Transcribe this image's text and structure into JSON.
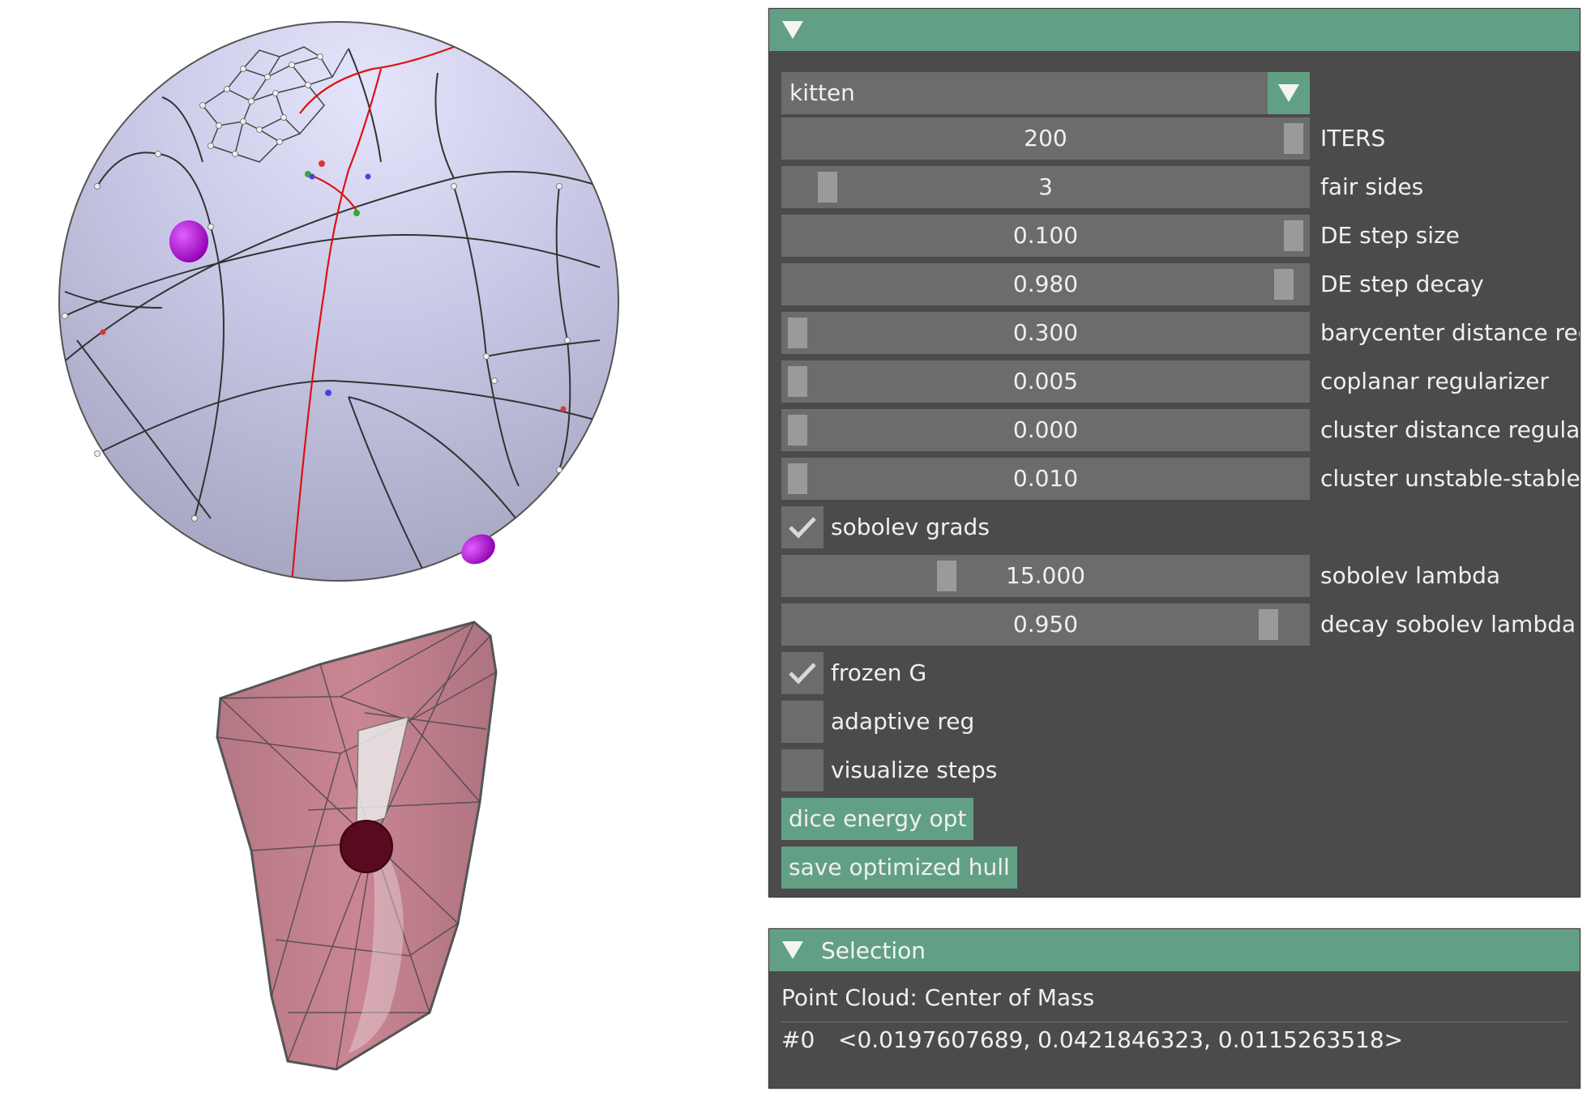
{
  "colors": {
    "accent": "#62a085",
    "panel_bg": "#4b4b4b",
    "widget_bg": "#6c6c6c",
    "sphere": "#c8c8e6",
    "hull": "#b06070",
    "marker": "#b000c8",
    "path": "#dd1111"
  },
  "main_panel": {
    "collapse_icon": "triangle-down-icon",
    "mesh_select": {
      "value": "kitten",
      "icon": "chevron-down-icon"
    },
    "sliders": [
      {
        "name": "iters",
        "value": "200",
        "label": "ITERS",
        "level": 1.0
      },
      {
        "name": "fair-sides",
        "value": "3",
        "label": "fair sides",
        "level": 0.06
      },
      {
        "name": "de-step-size",
        "value": "0.100",
        "label": "DE step size",
        "level": 1.0
      },
      {
        "name": "de-step-decay",
        "value": "0.980",
        "label": "DE step decay",
        "level": 0.98
      },
      {
        "name": "barycenter-distance",
        "value": "0.300",
        "label": "barycenter distance regu",
        "level": 0.0
      },
      {
        "name": "coplanar-regularizer",
        "value": "0.005",
        "label": "coplanar regularizer",
        "level": 0.0
      },
      {
        "name": "cluster-distance",
        "value": "0.000",
        "label": "cluster distance regulariz",
        "level": 0.0
      },
      {
        "name": "cluster-unstable-stable",
        "value": "0.010",
        "label": "cluster unstable-stable a",
        "level": 0.0
      }
    ],
    "sobolev_grads": {
      "label": "sobolev grads",
      "checked": true
    },
    "sliders2": [
      {
        "name": "sobolev-lambda",
        "value": "15.000",
        "label": "sobolev lambda",
        "level": 0.3
      },
      {
        "name": "decay-sobolev-lambda",
        "value": "0.950",
        "label": "decay sobolev lambda",
        "level": 0.95
      }
    ],
    "frozen_g": {
      "label": "frozen G",
      "checked": true
    },
    "adaptive_reg": {
      "label": "adaptive reg",
      "checked": false
    },
    "visualize_steps": {
      "label": "visualize steps",
      "checked": false
    },
    "buttons": {
      "dice": "dice energy opt",
      "save": "save optimized hull"
    }
  },
  "selection_panel": {
    "title": "Selection",
    "heading": "Point Cloud: Center of Mass",
    "index": "#0",
    "value": "<0.0197607689, 0.0421846323, 0.0115263518>"
  }
}
